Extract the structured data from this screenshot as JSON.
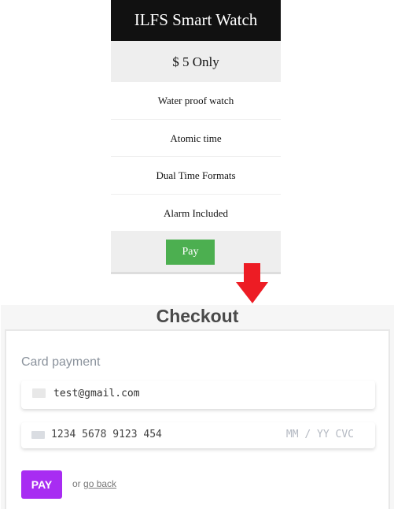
{
  "product": {
    "title": "ILFS Smart Watch",
    "price": "$ 5 Only",
    "features": [
      "Water proof watch",
      "Atomic time",
      "Dual Time Formats",
      "Alarm Included"
    ],
    "pay_label": "Pay"
  },
  "arrow": {
    "icon": "arrow-down-icon",
    "color": "#ed1c24"
  },
  "checkout": {
    "title": "Checkout",
    "section_label": "Card payment",
    "email_value": "test@gmail.com",
    "card_number_value": "1234 5678 9123 454",
    "expiry_cvc_placeholder": "MM / YY CVC",
    "pay_label": "PAY",
    "or_text": "or ",
    "go_back_label": "go back",
    "accent": "#a82cf2"
  }
}
